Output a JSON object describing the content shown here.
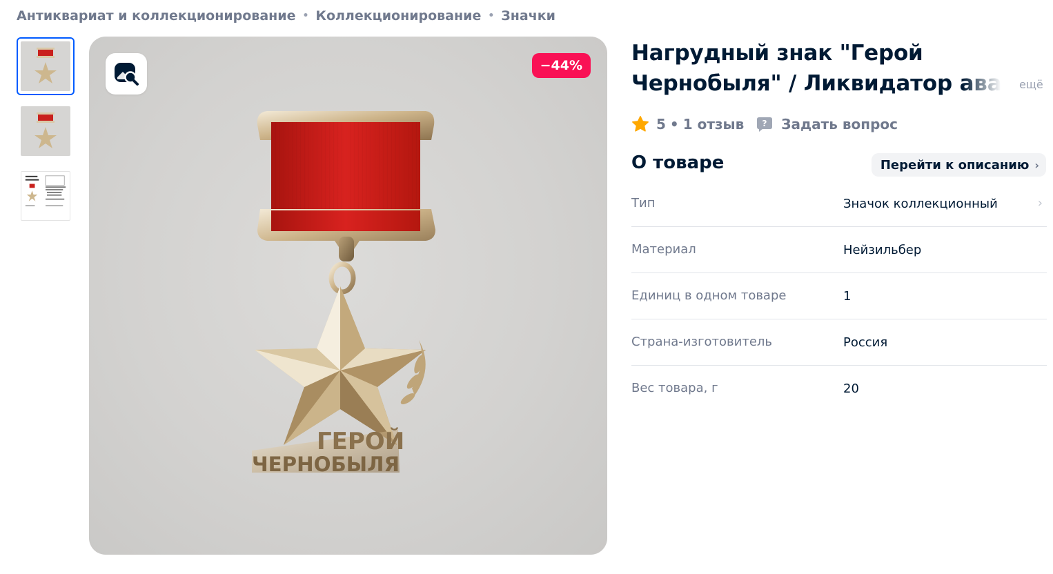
{
  "breadcrumb": {
    "items": [
      "Антиквариат и коллекционирование",
      "Коллекционирование",
      "Значки"
    ],
    "separator": "•"
  },
  "gallery": {
    "discount_badge": "−44%",
    "thumbnail_count": 3,
    "medal_ribbon_color": "#d8221f",
    "medal_inscription_line1": "ГЕРОЙ",
    "medal_inscription_line2": "ЧЕРНОБЫЛЯ"
  },
  "product": {
    "title": "Нагрудный знак \"Герой Чернобыля\" / Ликвидатор ава",
    "more_link": "ещё",
    "rating_value": "5",
    "rating_separator": "•",
    "reviews": "1 отзыв",
    "ask_question": "Задать вопрос"
  },
  "about": {
    "title": "О товаре",
    "goto_description": "Перейти к описанию",
    "properties": [
      {
        "label": "Тип",
        "value": "Значок коллекционный"
      },
      {
        "label": "Материал",
        "value": "Нейзильбер"
      },
      {
        "label": "Единиц в одном товаре",
        "value": "1"
      },
      {
        "label": "Страна-изготовитель",
        "value": "Россия"
      },
      {
        "label": "Вес товара, г",
        "value": "20"
      }
    ]
  },
  "colors": {
    "accent_blue": "#005bff",
    "discount_pink": "#f91155",
    "star_orange": "#ffa800",
    "text_primary": "#001a34",
    "text_secondary": "#70798d"
  },
  "icons": {
    "lens": "image-search-icon",
    "star": "star-icon",
    "chat": "chat-question-icon",
    "chevron": "chevron-right-icon"
  }
}
